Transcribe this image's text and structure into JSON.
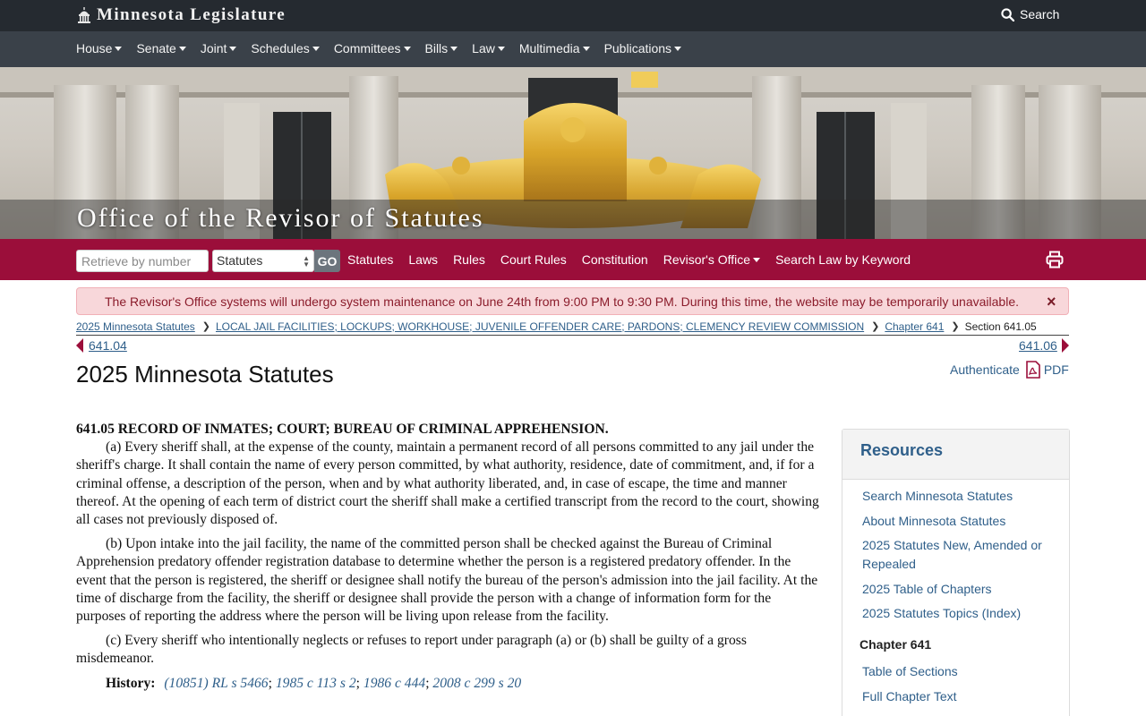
{
  "header": {
    "brand": "Minnesota Legislature",
    "search_label": "Search"
  },
  "nav": {
    "items": [
      "House",
      "Senate",
      "Joint",
      "Schedules",
      "Committees",
      "Bills",
      "Law",
      "Multimedia",
      "Publications"
    ]
  },
  "banner": {
    "title": "Office of the Revisor of Statutes"
  },
  "toolbar": {
    "retrieve_placeholder": "Retrieve by number",
    "type_selected": "Statutes",
    "go_label": "GO",
    "links": [
      "Statutes",
      "Laws",
      "Rules",
      "Court Rules",
      "Constitution",
      "Revisor's Office",
      "Search Law by Keyword"
    ]
  },
  "alert": {
    "text": "The Revisor's Office systems will undergo system maintenance on June 24th from 9:00 PM to 9:30 PM. During this time, the website may be temporarily unavailable.",
    "close": "×"
  },
  "breadcrumb": {
    "items": [
      "2025 Minnesota Statutes",
      "LOCAL JAIL FACILITIES; LOCKUPS; WORKHOUSE; JUVENILE OFFENDER CARE; PARDONS; CLEMENCY REVIEW COMMISSION",
      "Chapter 641"
    ],
    "current": "Section 641.05"
  },
  "pager": {
    "prev": "641.04",
    "next": "641.06"
  },
  "main": {
    "title": "2025 Minnesota Statutes",
    "authenticate": "Authenticate",
    "pdf": "PDF"
  },
  "statute": {
    "heading": "641.05 RECORD OF INMATES; COURT; BUREAU OF CRIMINAL APPREHENSION.",
    "paragraphs": [
      "(a) Every sheriff shall, at the expense of the county, maintain a permanent record of all persons committed to any jail under the sheriff's charge. It shall contain the name of every person committed, by what authority, residence, date of commitment, and, if for a criminal offense, a description of the person, when and by what authority liberated, and, in case of escape, the time and manner thereof. At the opening of each term of district court the sheriff shall make a certified transcript from the record to the court, showing all cases not previously disposed of.",
      "(b) Upon intake into the jail facility, the name of the committed person shall be checked against the Bureau of Criminal Apprehension predatory offender registration database to determine whether the person is a registered predatory offender. In the event that the person is registered, the sheriff or designee shall notify the bureau of the person's admission into the jail facility. At the time of discharge from the facility, the sheriff or designee shall provide the person with a change of information form for the purposes of reporting the address where the person will be living upon release from the facility.",
      "(c) Every sheriff who intentionally neglects or refuses to report under paragraph (a) or (b) shall be guilty of a gross misdemeanor."
    ],
    "history_label": "History:",
    "history_items": [
      "(10851)",
      "RL s 5466",
      "1985 c 113 s 2",
      "1986 c 444",
      "2008 c 299 s 20"
    ]
  },
  "resources": {
    "title": "Resources",
    "links": [
      "Search Minnesota Statutes",
      "About Minnesota Statutes",
      "2025 Statutes New, Amended or Repealed",
      "2025 Table of Chapters",
      "2025 Statutes Topics (Index)"
    ],
    "chapter_heading": "Chapter 641",
    "chapter_links": [
      "Table of Sections",
      "Full Chapter Text"
    ]
  },
  "colors": {
    "topbar": "#252a30",
    "nav": "#3a4149",
    "maroon": "#9b0e3a",
    "link": "#2f5f8a",
    "alert_bg": "#f8d7da"
  }
}
